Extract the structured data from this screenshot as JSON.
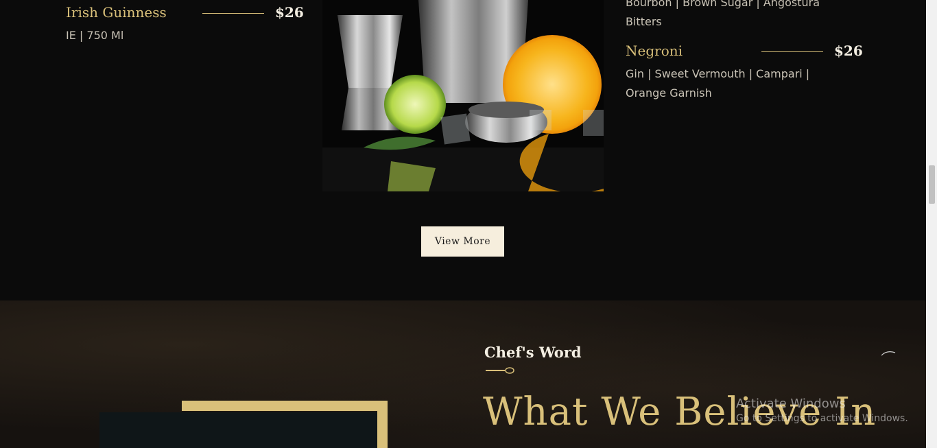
{
  "menu": {
    "left_item": {
      "name": "Irish Guinness",
      "price": "$26",
      "desc": "IE | 750 Ml"
    },
    "right_top_desc": [
      "Bourbon | Brown Sugar | Angostura",
      "Bitters"
    ],
    "right_item": {
      "name": "Negroni",
      "price": "$26",
      "desc_lines": [
        "Gin | Sweet Vermouth | Campari |",
        "Orange Garnish"
      ]
    }
  },
  "view_more": {
    "label": "View More"
  },
  "about": {
    "subtitle": "Chef's Word",
    "heading": "What We Believe In"
  },
  "watermark": {
    "title": "Activate Windows",
    "subtitle": "Go to Settings to activate Windows."
  },
  "colors": {
    "gold": "#d9c07a",
    "cream": "#f6eedd",
    "background": "#0b0b0b"
  }
}
